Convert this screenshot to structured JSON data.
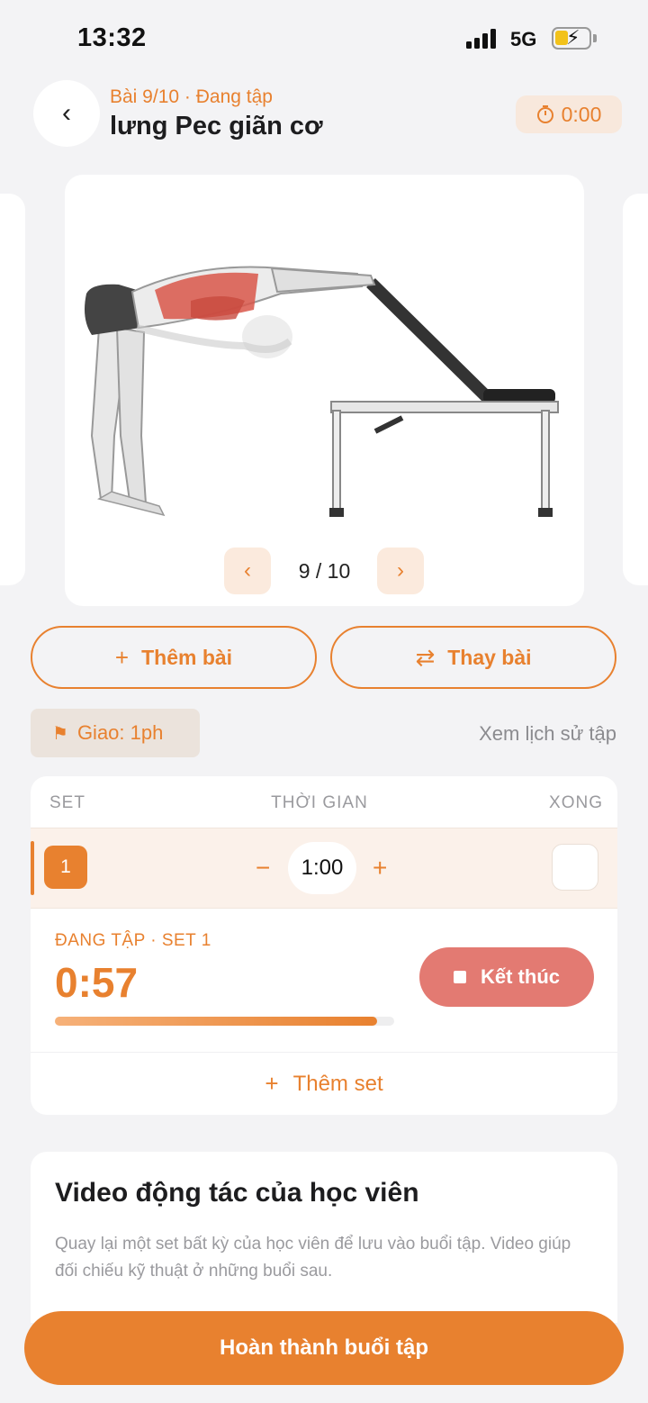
{
  "status_bar": {
    "time": "13:32",
    "network": "5G"
  },
  "header": {
    "subtitle": "Bài 9/10 · Đang tập",
    "title": "lưng Pec giãn cơ",
    "timer": "0:00"
  },
  "exercise": {
    "pager": "9 / 10"
  },
  "actions": {
    "add_exercise": "Thêm bài",
    "swap_exercise": "Thay bài"
  },
  "rest": {
    "label": "Giao: 1ph"
  },
  "history_link": "Xem lịch sử tập",
  "sets": {
    "headers": {
      "set": "SET",
      "time": "THỜI GIAN",
      "done": "XONG"
    },
    "rows": [
      {
        "number": "1",
        "time": "1:00",
        "done": false
      }
    ],
    "active": {
      "label": "ĐANG TẬP · SET 1",
      "timer": "0:57",
      "progress": 0.95,
      "end_label": "Kết thúc"
    },
    "add_set": "Thêm set"
  },
  "video": {
    "title": "Video động tác của học viên",
    "description": "Quay lại một set bất kỳ của học viên để lưu vào buổi tập. Video giúp đối chiếu kỹ thuật ở những buổi sau."
  },
  "finish_button": "Hoàn thành buổi tập",
  "colors": {
    "accent": "#e8812f",
    "end": "#e37a72",
    "background": "#f3f3f5"
  }
}
